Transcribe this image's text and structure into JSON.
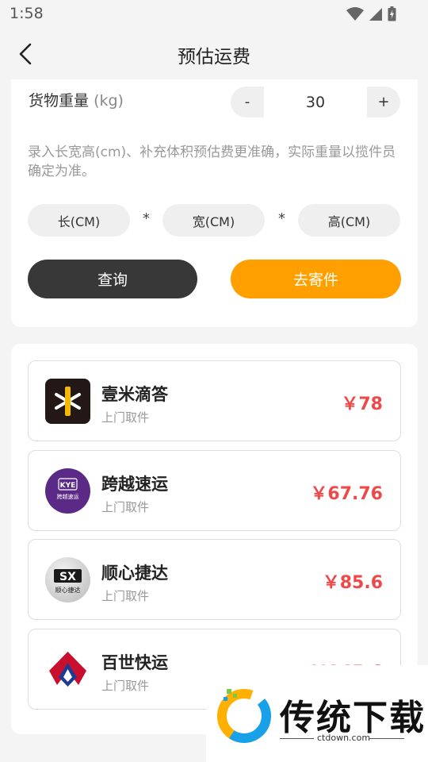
{
  "status_bar": {
    "time": "1:58"
  },
  "nav": {
    "title": "预估运费"
  },
  "weight": {
    "label": "货物重量",
    "unit": "(kg)",
    "value": "30",
    "minus": "-",
    "plus": "+"
  },
  "hint": "录入长宽高(cm)、补充体积预估费更准确，实际重量以揽件员确定为准。",
  "dimensions": {
    "length": "长(CM)",
    "width": "宽(CM)",
    "height": "高(CM)",
    "separator": "*"
  },
  "buttons": {
    "query": "查询",
    "send": "去寄件"
  },
  "carriers": [
    {
      "name": "壹米滴答",
      "sub": "上门取件",
      "price": "￥78",
      "logo_icon": "yimidida-logo-icon"
    },
    {
      "name": "跨越速运",
      "sub": "上门取件",
      "price": "￥67.76",
      "logo_icon": "kye-logo-icon",
      "logo_text": "KYE",
      "logo_subtext": "跨越速运"
    },
    {
      "name": "顺心捷达",
      "sub": "上门取件",
      "price": "￥85.6",
      "logo_icon": "sx-logo-icon",
      "logo_text": "SX",
      "logo_subtext": "顺心捷达"
    },
    {
      "name": "百世快运",
      "sub": "上门取件",
      "price": "￥145.6",
      "logo_icon": "baishi-logo-icon"
    }
  ],
  "watermark": {
    "text": "传统下载",
    "url": "ctdown.com"
  },
  "colors": {
    "accent": "#ffa000",
    "dark_button": "#383838",
    "price": "#f04848",
    "kye_purple": "#5b2a86"
  }
}
